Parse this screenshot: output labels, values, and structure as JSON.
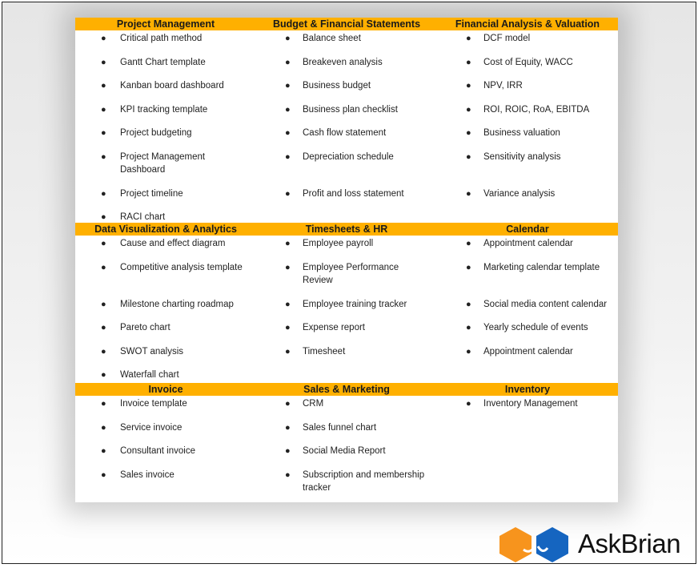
{
  "sections": [
    {
      "columns": [
        {
          "header": "Project Management",
          "items": [
            "Critical path method",
            "Gantt Chart template",
            "Kanban board dashboard",
            "KPI tracking template",
            "Project budgeting",
            "Project Management Dashboard",
            "Project timeline",
            "RACI chart"
          ]
        },
        {
          "header": "Budget & Financial Statements",
          "items": [
            "Balance sheet",
            "Breakeven analysis",
            "Business budget",
            "Business plan checklist",
            "Cash flow statement",
            "Depreciation schedule",
            "Profit and loss statement"
          ]
        },
        {
          "header": "Financial Analysis & Valuation",
          "items": [
            "DCF model",
            "Cost of Equity, WACC",
            "NPV, IRR",
            "ROI, ROIC, RoA, EBITDA",
            "Business valuation",
            "Sensitivity analysis",
            "Variance analysis"
          ]
        }
      ]
    },
    {
      "columns": [
        {
          "header": "Data Visualization & Analytics",
          "items": [
            "Cause and effect diagram",
            "Competitive analysis template",
            "Milestone charting roadmap",
            "Pareto chart",
            "SWOT analysis",
            "Waterfall chart"
          ]
        },
        {
          "header": "Timesheets & HR",
          "items": [
            "Employee payroll",
            "Employee Performance Review",
            "Employee training tracker",
            "Expense report",
            "Timesheet"
          ]
        },
        {
          "header": "Calendar",
          "items": [
            "Appointment calendar",
            "Marketing calendar template",
            "Social media content calendar",
            "Yearly schedule of events",
            "Appointment calendar"
          ]
        }
      ]
    },
    {
      "columns": [
        {
          "header": "Invoice",
          "items": [
            "Invoice template",
            "Service invoice",
            "Consultant invoice",
            "Sales invoice"
          ]
        },
        {
          "header": "Sales & Marketing",
          "items": [
            "CRM",
            "Sales funnel chart",
            "Social Media Report",
            "Subscription and membership tracker"
          ]
        },
        {
          "header": "Inventory",
          "items": [
            "Inventory Management"
          ]
        }
      ]
    }
  ],
  "bullet": "●",
  "logo": {
    "text": "AskBrian",
    "colors": {
      "orange": "#f7941d",
      "blue": "#1565c0"
    }
  },
  "accent": "#ffb000"
}
